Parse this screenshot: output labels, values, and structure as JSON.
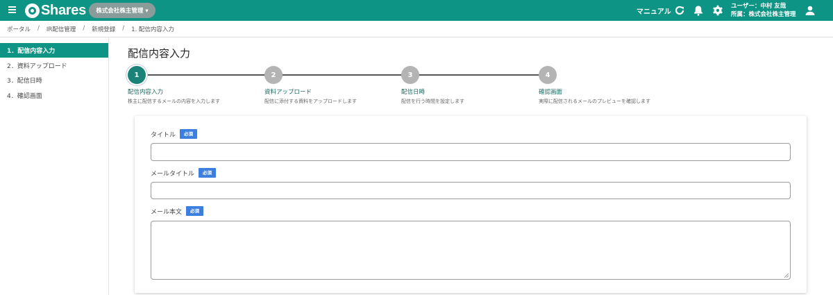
{
  "header": {
    "logo_text": "Shares",
    "company": "株式会社株主管理 ▾",
    "manual": "マニュアル",
    "user_line1": "ユーザー：中村 友哉",
    "user_line2": "所属：株式会社株主管理"
  },
  "breadcrumb": [
    "ポータル",
    "IR配信管理",
    "新規登録",
    "1. 配信内容入力"
  ],
  "sidebar": {
    "items": [
      {
        "label": "1．配信内容入力",
        "active": true
      },
      {
        "label": "2．資料アップロード"
      },
      {
        "label": "3．配信日時"
      },
      {
        "label": "4．確認画面"
      }
    ]
  },
  "page_title": "配信内容入力",
  "steps": [
    {
      "num": "1",
      "label": "配信内容入力",
      "desc": "株主に配信するメールの内容を入力します"
    },
    {
      "num": "2",
      "label": "資料アップロード",
      "desc": "配信に添付する資料をアップロードします"
    },
    {
      "num": "3",
      "label": "配信日時",
      "desc": "配信を行う時間を設定します"
    },
    {
      "num": "4",
      "label": "確認画面",
      "desc": "実際に配信されるメールのプレビューを確認します"
    }
  ],
  "form": {
    "title_label": "タイトル",
    "mail_title_label": "メールタイトル",
    "mail_body_label": "メール本文",
    "required_badge": "必須"
  },
  "colors": {
    "primary": "#0d9484",
    "required": "#3c7fe0"
  }
}
